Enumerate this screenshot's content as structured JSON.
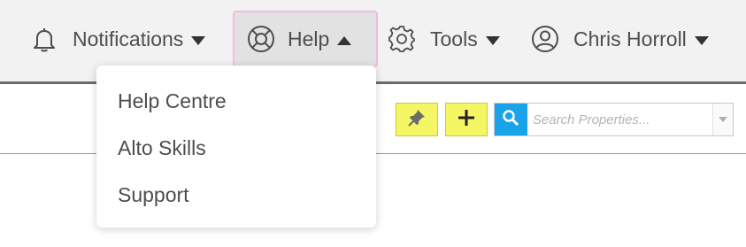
{
  "nav": {
    "notifications": {
      "label": "Notifications",
      "icon": "bell-icon"
    },
    "help": {
      "label": "Help",
      "icon": "lifebuoy-icon",
      "expanded": true
    },
    "tools": {
      "label": "Tools",
      "icon": "gear-icon"
    },
    "user": {
      "label": "Chris Horroll",
      "icon": "user-icon"
    }
  },
  "help_menu": {
    "items": [
      {
        "label": "Help Centre"
      },
      {
        "label": "Alto Skills"
      },
      {
        "label": "Support"
      }
    ]
  },
  "toolbar": {
    "pin_icon": "pin-icon",
    "add_icon": "plus-icon",
    "search": {
      "placeholder": "Search Properties..."
    }
  },
  "colors": {
    "accent_yellow": "#f4f763",
    "search_blue": "#1aa3e8",
    "active_border": "#f3b8e6"
  }
}
